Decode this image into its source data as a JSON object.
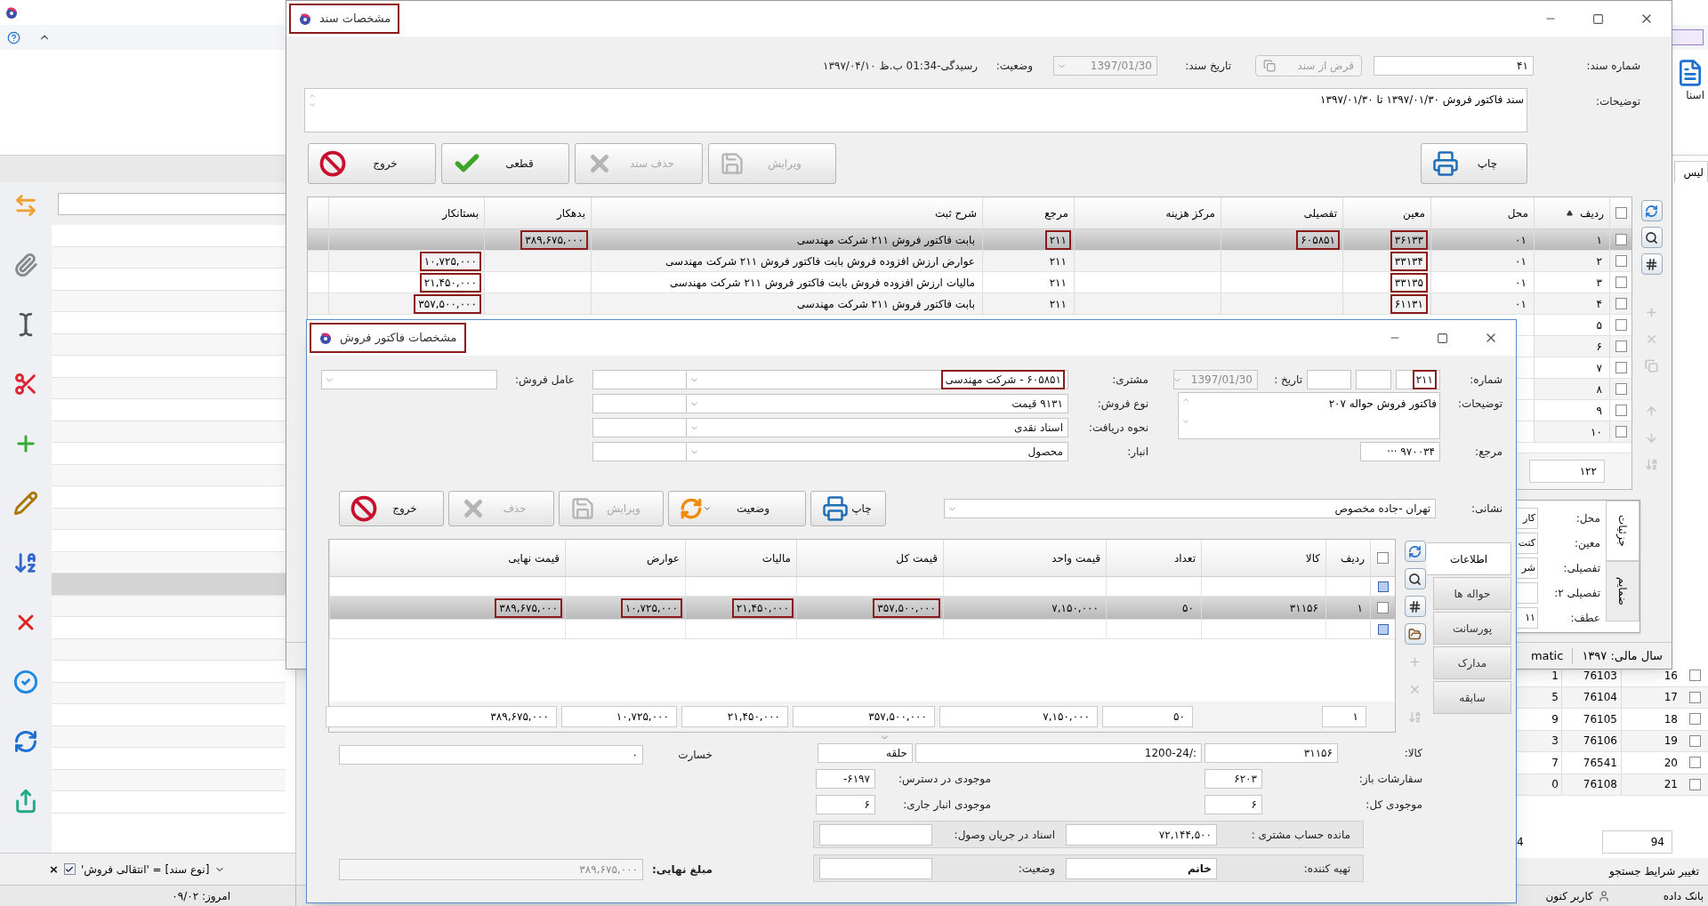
{
  "background": {
    "left_panel": {
      "filter": {
        "text": "[نوع سند] = 'انتقالی فروش'",
        "checked": true,
        "clear": "×"
      },
      "today": "امروز: ۰۹/۰۲"
    },
    "right_panel": {
      "ribbon_label": "اسنا",
      "tab_label": "لیس",
      "rows": [
        {
          "checked": false,
          "number": "16",
          "code": "76103",
          "column_3": "1"
        },
        {
          "checked": false,
          "number": "17",
          "code": "76104",
          "column_3": "5"
        },
        {
          "checked": false,
          "number": "18",
          "code": "76105",
          "column_3": "9"
        },
        {
          "checked": false,
          "number": "19",
          "code": "76106",
          "column_3": "3"
        },
        {
          "checked": false,
          "number": "20",
          "code": "76541",
          "column_3": "7"
        },
        {
          "checked": false,
          "number": "21",
          "code": "76108",
          "column_3": "0"
        }
      ],
      "footer_count": "94",
      "footer_partial": "4",
      "search_link": "تغییر شرایط جستجو",
      "status": [
        "بانک داده",
        "کاربر کنون"
      ]
    }
  },
  "document_dialog": {
    "title": {
      "text": "مشخصات سند",
      "highlighted": true
    },
    "fields": {
      "number_label": "شماره سند:",
      "number": "۴۱",
      "borrow_button": {
        "label": "قرض از سند",
        "disabled": true
      },
      "date_label": "تاریخ سند:",
      "date": "1397/01/30",
      "date_disabled": true,
      "status_label": "وضعیت:",
      "status": "رسیدگی-01:34 ب.ظ ۱۳۹۷/۰۴/۱۰",
      "notes_label": "توضیحات:",
      "notes": "سند فاکتور فروش ۱۳۹۷/۰۱/۳۰ تا ۱۳۹۷/۰۱/۳۰"
    },
    "buttons": [
      {
        "kind": "print",
        "label": "چاپ",
        "disabled": false
      },
      {
        "kind": "edit",
        "label": "ویرایش",
        "disabled": true
      },
      {
        "kind": "delete",
        "label": "حذف سند",
        "disabled": true
      },
      {
        "kind": "confirm",
        "label": "قطعی",
        "disabled": false
      },
      {
        "kind": "exit",
        "label": "خروج",
        "disabled": false
      }
    ],
    "table": {
      "all_checked": false,
      "columns": [
        "ردیف",
        "محل",
        "معین",
        "تفصیلی",
        "مرکز هزینه",
        "مرجع",
        "شرح ثبت",
        "بدهکار",
        "بستانکار"
      ],
      "rows": [
        {
          "selected": true,
          "checked": false,
          "cells": [
            {
              "text": "۱",
              "highlighted": false
            },
            {
              "text": "۰۱",
              "highlighted": false
            },
            {
              "text": "۳۶۱۳۳",
              "highlighted": true
            },
            {
              "text": "۶۰۵۸۵۱",
              "highlighted": true
            },
            {},
            {
              "text": "۲۱۱",
              "highlighted": true
            },
            {
              "text": "بابت فاکتور فروش ۲۱۱ شرکت مهندسی",
              "highlighted": false
            },
            {
              "text": "۳۸۹,۶۷۵,۰۰۰",
              "highlighted": true
            },
            {}
          ]
        },
        {
          "selected": false,
          "checked": false,
          "cells": [
            {
              "text": "۲",
              "highlighted": false
            },
            {
              "text": "۰۱",
              "highlighted": false
            },
            {
              "text": "۳۳۱۳۴",
              "highlighted": true
            },
            {},
            {},
            {
              "text": "۲۱۱",
              "highlighted": false
            },
            {
              "text": "عوارض ارزش افزوده فروش بابت فاکتور فروش ۲۱۱ شرکت مهندسی",
              "highlighted": false
            },
            {},
            {
              "text": "۱۰,۷۲۵,۰۰۰",
              "highlighted": true
            }
          ]
        },
        {
          "selected": false,
          "checked": false,
          "cells": [
            {
              "text": "۳",
              "highlighted": false
            },
            {
              "text": "۰۱",
              "highlighted": false
            },
            {
              "text": "۳۳۱۳۵",
              "highlighted": true
            },
            {},
            {},
            {
              "text": "۲۱۱",
              "highlighted": false
            },
            {
              "text": "مالیات ارزش افزوده فروش بابت فاکتور فروش ۲۱۱ شرکت مهندسی",
              "highlighted": false
            },
            {},
            {
              "text": "۲۱,۴۵۰,۰۰۰",
              "highlighted": true
            }
          ]
        },
        {
          "selected": false,
          "checked": false,
          "cells": [
            {
              "text": "۴",
              "highlighted": false
            },
            {
              "text": "۰۱",
              "highlighted": false
            },
            {
              "text": "۶۱۱۳۱",
              "highlighted": true
            },
            {},
            {},
            {
              "text": "۲۱۱",
              "highlighted": false
            },
            {
              "text": "بابت فاکتور فروش ۲۱۱ شرکت مهندسی",
              "highlighted": false
            },
            {},
            {
              "text": "۳۵۷,۵۰۰,۰۰۰",
              "highlighted": true
            }
          ]
        },
        {
          "selected": false,
          "checked": false,
          "cells": [
            {
              "text": "۵",
              "highlighted": false
            }
          ]
        },
        {
          "selected": false,
          "checked": false,
          "cells": [
            {
              "text": "۶",
              "highlighted": false
            }
          ]
        },
        {
          "selected": false,
          "checked": false,
          "cells": [
            {
              "text": "۷",
              "highlighted": false
            }
          ]
        },
        {
          "selected": false,
          "checked": false,
          "cells": [
            {
              "text": "۸",
              "highlighted": false
            }
          ]
        },
        {
          "selected": false,
          "checked": false,
          "cells": [
            {
              "text": "۹",
              "highlighted": false
            }
          ]
        },
        {
          "selected": false,
          "checked": false,
          "cells": [
            {
              "text": "۱۰",
              "highlighted": false
            }
          ]
        }
      ],
      "count": "۱۲۲"
    },
    "detail_popup": {
      "tabs": [
        {
          "label": "جزئیات",
          "selected": true
        },
        {
          "label": "ضمایم",
          "selected": false
        }
      ],
      "fields": [
        {
          "label": "محل:",
          "value": "کار"
        },
        {
          "label": "معین:",
          "value": "کنت"
        },
        {
          "label": "تفصیلی:",
          "value": "شر"
        },
        {
          "label": "تفصیلی ۲:"
        },
        {
          "label": "عطف:",
          "value": "۱۱"
        }
      ]
    },
    "status_bar": {
      "fiscal_year": "سال مالی: ۱۳۹۷",
      "partial": "matic"
    }
  },
  "invoice_dialog": {
    "title": {
      "text": "مشخصات فاکتور فروش",
      "highlighted": true
    },
    "header": {
      "number": {
        "label": "شماره:",
        "value": "۲۱۱",
        "highlighted": true
      },
      "date": {
        "label": "تاریخ :",
        "value": "1397/01/30"
      },
      "customer": {
        "label": "مشتری:",
        "value": "۶۰۵۸۵۱ - شرکت مهندسی",
        "highlighted": true
      },
      "sales_agent": {
        "label": "عامل فروش:"
      },
      "notes": {
        "label": "توضیحات:",
        "value": "فاکتور فروش حواله ۲۰۷"
      },
      "sale_type": {
        "label": "نوع فروش:",
        "value": "۹۱۳۱ قیمت"
      },
      "payment": {
        "label": "نحوه دریافت:",
        "value": "اسناد نقدی"
      },
      "warehouse": {
        "label": "انبار:",
        "value": "محصول"
      },
      "reference": {
        "label": "مرجع:",
        "value": "۹۷۰۰۳۴ ···"
      },
      "address": {
        "label": "نشانی:",
        "value": "تهران -جاده مخصوص"
      }
    },
    "buttons": [
      {
        "kind": "print",
        "label": "چاپ",
        "disabled": false
      },
      {
        "kind": "status",
        "label": "وضعیت",
        "disabled": false
      },
      {
        "kind": "edit",
        "label": "ویرایش",
        "disabled": true
      },
      {
        "kind": "delete",
        "label": "حذف",
        "disabled": true
      },
      {
        "kind": "exit",
        "label": "خروج",
        "disabled": false
      }
    ],
    "tabs": [
      {
        "label": "اطلاعات",
        "selected": true
      },
      {
        "label": "حواله ها",
        "selected": false
      },
      {
        "label": "پورسانت",
        "selected": false
      },
      {
        "label": "مدارک",
        "selected": false
      },
      {
        "label": "سابقه",
        "selected": false
      }
    ],
    "grid": {
      "all_checked": false,
      "columns": [
        "ردیف",
        "کالا",
        "تعداد",
        "قیمت واحد",
        "قیمت کل",
        "مالیات",
        "عوارض",
        "قیمت نهایی"
      ],
      "row": {
        "selected": true,
        "checked": false,
        "cells": [
          {
            "text": "۱",
            "highlighted": false
          },
          {
            "text": "۳۱۱۵۶",
            "highlighted": false
          },
          {
            "text": "۵۰",
            "highlighted": false
          },
          {
            "text": "۷,۱۵۰,۰۰۰",
            "highlighted": false
          },
          {
            "text": "۳۵۷,۵۰۰,۰۰۰",
            "highlighted": true
          },
          {
            "text": "۲۱,۴۵۰,۰۰۰",
            "highlighted": true
          },
          {
            "text": "۱۰,۷۲۵,۰۰۰",
            "highlighted": true
          },
          {
            "text": "۳۸۹,۶۷۵,۰۰۰",
            "highlighted": true
          }
        ]
      },
      "totals": {
        "row_count": "۱",
        "quantity": "۵۰",
        "unit_price": "۷,۱۵۰,۰۰۰",
        "total_price": "۳۵۷,۵۰۰,۰۰۰",
        "tax": "۲۱,۴۵۰,۰۰۰",
        "duties": "۱۰,۷۲۵,۰۰۰",
        "final_price": "۳۸۹,۶۷۵,۰۰۰"
      }
    },
    "bottom": {
      "item": {
        "label": "کالا:",
        "code": "۳۱۱۵۶",
        "name": "1200-24/:",
        "unit": "حلقه"
      },
      "open_orders": {
        "label": "سفارشات باز:",
        "value": "۶۲۰۳"
      },
      "available": {
        "label": "موجودی در دسترس:",
        "value": "۶۱۹۷-"
      },
      "total_stock": {
        "label": "موجودی کل:",
        "value": "۶"
      },
      "current_stock": {
        "label": "موجودی انبار جاری:",
        "value": "۶"
      },
      "damage": {
        "label": "خسارت",
        "value": "۰"
      },
      "balance": {
        "label": "مانده حساب مشتری :",
        "value": "۷۲,۱۴۴,۵۰۰"
      },
      "collecting": {
        "label": "اسناد در جریان وصول:"
      },
      "preparer": {
        "label": "تهیه کننده:",
        "value": "خانم"
      },
      "status": {
        "label": "وضعیت:"
      },
      "final_amount": {
        "label": "مبلغ نهایی:",
        "value": "۳۸۹,۶۷۵,۰۰۰"
      }
    }
  }
}
